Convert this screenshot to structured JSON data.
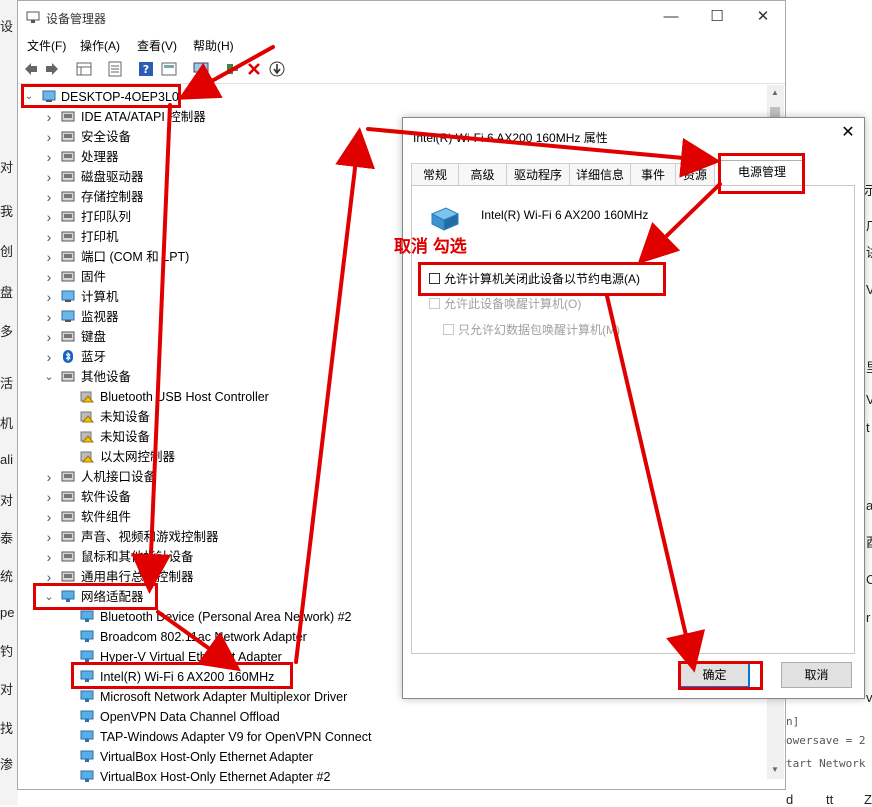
{
  "window": {
    "title": "设备管理器",
    "controls": [
      "—",
      "☐",
      "✕"
    ]
  },
  "menu": [
    "文件(F)",
    "操作(A)",
    "查看(V)",
    "帮助(H)"
  ],
  "toolbar_icons": [
    "back-icon",
    "forward-icon",
    "properties-grid-icon",
    "list-icon",
    "help-icon",
    "view-icon",
    "monitor-icon",
    "enable-device-icon",
    "uninstall-x-icon",
    "update-driver-icon"
  ],
  "tree": {
    "root": "DESKTOP-4OEP3L0",
    "items": [
      {
        "label": "IDE ATA/ATAPI 控制器",
        "expanded": false,
        "level": 1
      },
      {
        "label": "安全设备",
        "expanded": false,
        "level": 1
      },
      {
        "label": "处理器",
        "expanded": false,
        "level": 1
      },
      {
        "label": "磁盘驱动器",
        "expanded": false,
        "level": 1
      },
      {
        "label": "存储控制器",
        "expanded": false,
        "level": 1
      },
      {
        "label": "打印队列",
        "expanded": false,
        "level": 1
      },
      {
        "label": "打印机",
        "expanded": false,
        "level": 1
      },
      {
        "label": "端口 (COM 和 LPT)",
        "expanded": false,
        "level": 1
      },
      {
        "label": "固件",
        "expanded": false,
        "level": 1
      },
      {
        "label": "计算机",
        "expanded": false,
        "level": 1
      },
      {
        "label": "监视器",
        "expanded": false,
        "level": 1
      },
      {
        "label": "键盘",
        "expanded": false,
        "level": 1
      },
      {
        "label": "蓝牙",
        "expanded": false,
        "level": 1
      },
      {
        "label": "其他设备",
        "expanded": true,
        "level": 1
      },
      {
        "label": "Bluetooth USB Host Controller",
        "level": 2
      },
      {
        "label": "未知设备",
        "level": 2
      },
      {
        "label": "未知设备",
        "level": 2
      },
      {
        "label": "以太网控制器",
        "level": 2
      },
      {
        "label": "人机接口设备",
        "expanded": false,
        "level": 1
      },
      {
        "label": "软件设备",
        "expanded": false,
        "level": 1
      },
      {
        "label": "软件组件",
        "expanded": false,
        "level": 1
      },
      {
        "label": "声音、视频和游戏控制器",
        "expanded": false,
        "level": 1
      },
      {
        "label": "鼠标和其他指针设备",
        "expanded": false,
        "level": 1
      },
      {
        "label": "通用串行总线控制器",
        "expanded": false,
        "level": 1
      },
      {
        "label": "网络适配器",
        "expanded": true,
        "level": 1
      },
      {
        "label": "Bluetooth Device (Personal Area Network) #2",
        "level": 2
      },
      {
        "label": "Broadcom 802.11ac Network Adapter",
        "level": 2
      },
      {
        "label": "Hyper-V Virtual Ethernet Adapter",
        "level": 2
      },
      {
        "label": "Intel(R) Wi-Fi 6 AX200 160MHz",
        "level": 2
      },
      {
        "label": "Microsoft Network Adapter Multiplexor Driver",
        "level": 2
      },
      {
        "label": "OpenVPN Data Channel Offload",
        "level": 2
      },
      {
        "label": "TAP-Windows Adapter V9 for OpenVPN Connect",
        "level": 2
      },
      {
        "label": "VirtualBox Host-Only Ethernet Adapter",
        "level": 2
      },
      {
        "label": "VirtualBox Host-Only Ethernet Adapter #2",
        "level": 2
      }
    ]
  },
  "dialog": {
    "title": "Intel(R) Wi-Fi 6 AX200 160MHz 属性",
    "tabs": [
      "常规",
      "高级",
      "驱动程序",
      "详细信息",
      "事件",
      "资源",
      "电源管理"
    ],
    "active_tab": "电源管理",
    "device_name": "Intel(R) Wi-Fi 6 AX200 160MHz",
    "options": [
      {
        "label": "允许计算机关闭此设备以节约电源(A)",
        "checked": false,
        "enabled": true
      },
      {
        "label": "允许此设备唤醒计算机(O)",
        "checked": false,
        "enabled": false
      },
      {
        "label": "只允许幻数据包唤醒计算机(M)",
        "checked": false,
        "enabled": false
      }
    ],
    "ok_label": "确定",
    "cancel_label": "取消"
  },
  "annotation": {
    "text": "取消 勾选",
    "color": "#e00000"
  },
  "background": {
    "left_fragments": [
      "设",
      "对",
      "我",
      "创",
      "盘",
      "多",
      "活",
      "机",
      "ali",
      "对",
      "泰",
      "统",
      "pe",
      "钓",
      "对",
      "找",
      "渗"
    ],
    "right_fragments": [
      "示",
      "广",
      "讲",
      "Vr",
      "里",
      "V",
      "t",
      "a",
      "酉",
      "C",
      "n]",
      "owersave = 2",
      "tart Network",
      "r",
      "v",
      "Z",
      "tt",
      "d"
    ]
  }
}
